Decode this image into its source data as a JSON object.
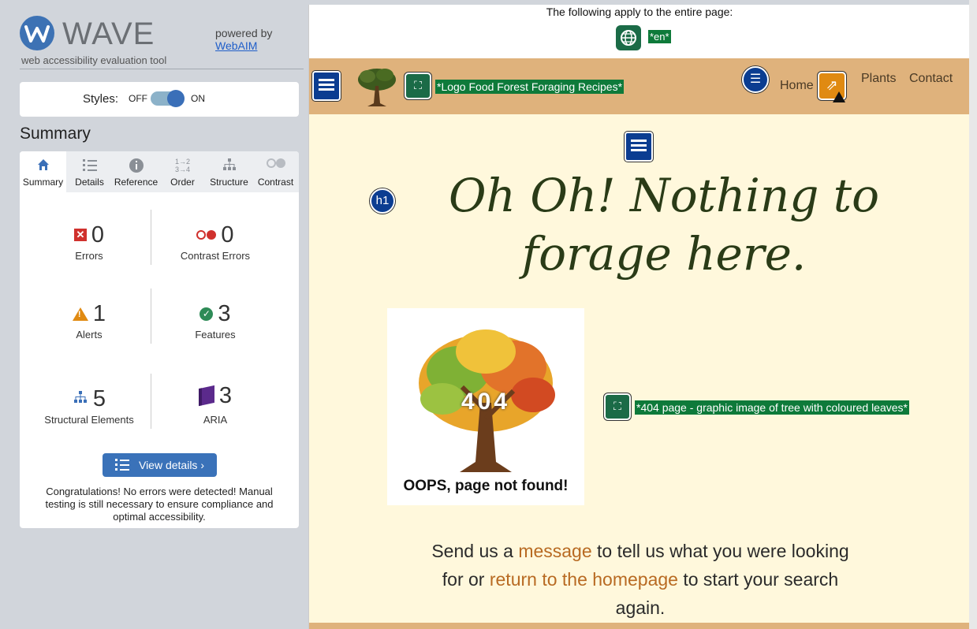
{
  "sidebar": {
    "logo_word": "WAVE",
    "logo_tagline": "web accessibility evaluation tool",
    "powered_by": "powered by",
    "powered_link": "WebAIM",
    "styles_label": "Styles:",
    "styles_off": "OFF",
    "styles_on": "ON",
    "summary_title": "Summary",
    "tabs": [
      {
        "label": "Summary",
        "icon": "home-icon"
      },
      {
        "label": "Details",
        "icon": "list-icon"
      },
      {
        "label": "Reference",
        "icon": "info-icon"
      },
      {
        "label": "Order",
        "icon": "order-icon"
      },
      {
        "label": "Structure",
        "icon": "structure-icon"
      },
      {
        "label": "Contrast",
        "icon": "contrast-icon"
      }
    ],
    "stats": {
      "errors": {
        "value": "0",
        "label": "Errors"
      },
      "contrast_errors": {
        "value": "0",
        "label": "Contrast Errors"
      },
      "alerts": {
        "value": "1",
        "label": "Alerts"
      },
      "features": {
        "value": "3",
        "label": "Features"
      },
      "structural": {
        "value": "5",
        "label": "Structural Elements"
      },
      "aria": {
        "value": "3",
        "label": "ARIA"
      }
    },
    "view_details": "View details ›",
    "congrats": "Congratulations! No errors were detected! Manual testing is still necessary to ensure compliance and optimal accessibility."
  },
  "page": {
    "apply_text": "The following apply to the entire page:",
    "lang_tag": "*en*",
    "logo_alt": "*Logo Food Forest Foraging Recipes*",
    "nav": [
      "Home",
      "Plants",
      "Contact"
    ],
    "h1_badge": "h1",
    "heading": "Oh Oh! Nothing to forage here.",
    "img_code": "404",
    "img_caption": "OOPS, page not found!",
    "img_alt": "*404 page - graphic image of tree with coloured leaves*",
    "body_pre": "Send us a ",
    "body_link1": "message",
    "body_mid": " to tell us what you were looking for or ",
    "body_link2": "return to the homepage",
    "body_post": " to start your search again."
  },
  "colors": {
    "accent": "#3a6fb8",
    "header_bg": "#dfb27c",
    "main_bg": "#fff8dc",
    "alt_tag": "#0e7a3a",
    "heading_color": "#2a3b17",
    "link_color": "#b86a22"
  }
}
